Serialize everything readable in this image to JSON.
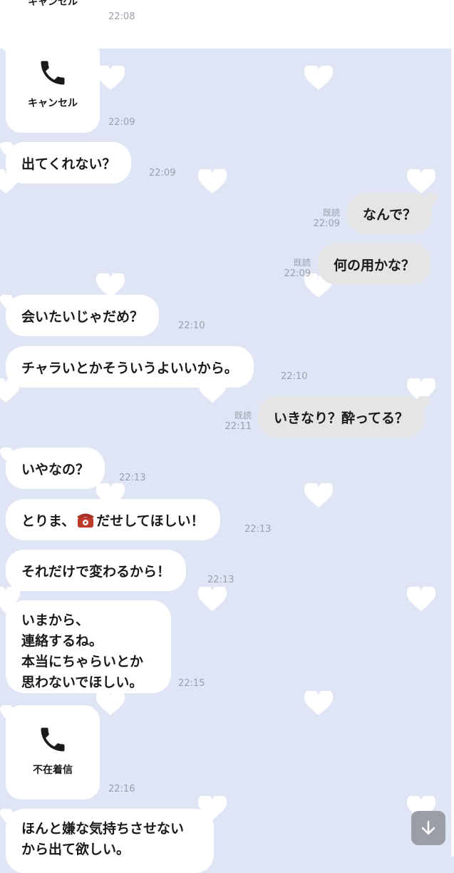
{
  "colors": {
    "background": "#dfe5f5",
    "incoming_bubble": "#ffffff",
    "outgoing_bubble": "#e5e5e5",
    "meta_text": "#9aa0ad",
    "scroll_button": "#9b9ea6"
  },
  "icons": {
    "call": "phone-icon",
    "telephone_emoji": "telephone-emoji",
    "scroll_down": "arrow-down-icon",
    "background_pattern": "heart-icon"
  },
  "messages": {
    "m0": {
      "label": "キャンセル",
      "time": "22:08"
    },
    "m1": {
      "label": "キャンセル",
      "time": "22:09"
    },
    "m2": {
      "text": "出てくれない？",
      "time": "22:09"
    },
    "m3": {
      "read": "既読",
      "time": "22:09",
      "text": "なんで？"
    },
    "m4": {
      "read": "既読",
      "time": "22:09",
      "text": "何の用かな？"
    },
    "m5": {
      "text": "会いたいじゃだめ？",
      "time": "22:10"
    },
    "m6": {
      "text": "チャラいとかそういうよいいから。",
      "time": "22:10"
    },
    "m7": {
      "read": "既読",
      "time": "22:11",
      "text": "いきなり？酔ってる？"
    },
    "m8": {
      "text": "いやなの？",
      "time": "22:13"
    },
    "m9": {
      "text_before": "とりま、",
      "text_after": "だせしてほしい！",
      "time": "22:13"
    },
    "m10": {
      "text": "それだけで変わるから！",
      "time": "22:13"
    },
    "m11": {
      "lines": [
        "いまから、",
        "連絡するね。",
        "本当にちゃらいとか",
        "思わないでほしい。"
      ],
      "time": "22:15"
    },
    "m12": {
      "label": "不在着信",
      "time": "22:16"
    },
    "m13": {
      "lines": [
        "ほんと嫌な気持ちさせない",
        "から出て欲しい。"
      ]
    }
  }
}
